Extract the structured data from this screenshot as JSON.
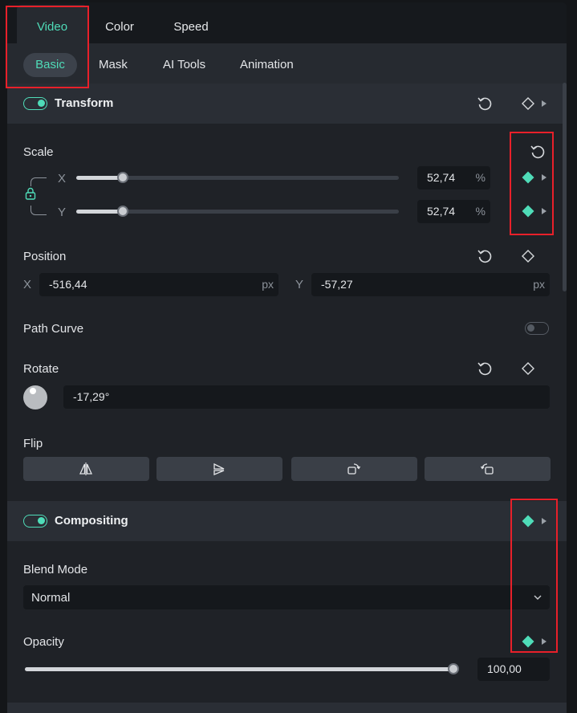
{
  "tabs": {
    "top": [
      {
        "label": "Video",
        "active": true
      },
      {
        "label": "Color",
        "active": false
      },
      {
        "label": "Speed",
        "active": false
      }
    ],
    "sub": [
      {
        "label": "Basic",
        "active": true
      },
      {
        "label": "Mask",
        "active": false
      },
      {
        "label": "AI Tools",
        "active": false
      },
      {
        "label": "Animation",
        "active": false
      }
    ]
  },
  "transform": {
    "title": "Transform",
    "enabled": true,
    "scale": {
      "label": "Scale",
      "x": {
        "axis": "X",
        "value": "52,74",
        "unit": "%",
        "slider_fraction": 0.14
      },
      "y": {
        "axis": "Y",
        "value": "52,74",
        "unit": "%",
        "slider_fraction": 0.14
      }
    },
    "position": {
      "label": "Position",
      "x": {
        "axis": "X",
        "value": "-516,44",
        "unit": "px"
      },
      "y": {
        "axis": "Y",
        "value": "-57,27",
        "unit": "px"
      }
    },
    "path_curve": {
      "label": "Path Curve",
      "enabled": false
    },
    "rotate": {
      "label": "Rotate",
      "value": "-17,29°"
    },
    "flip": {
      "label": "Flip"
    }
  },
  "compositing": {
    "title": "Compositing",
    "enabled": true,
    "blend_mode": {
      "label": "Blend Mode",
      "value": "Normal"
    },
    "opacity": {
      "label": "Opacity",
      "value": "100,00",
      "slider_fraction": 1.0
    }
  },
  "colors": {
    "accent": "#4fdcb8",
    "highlight": "#e8202a",
    "panel": "#1f2227",
    "header": "#2a2e35"
  },
  "icons": [
    "reset-icon",
    "keyframe-icon",
    "keyframe-filled-icon",
    "caret-right-icon",
    "lock-icon",
    "flip-horizontal-icon",
    "flip-vertical-icon",
    "rotate-cw-icon",
    "rotate-ccw-icon",
    "chevron-down-icon"
  ]
}
